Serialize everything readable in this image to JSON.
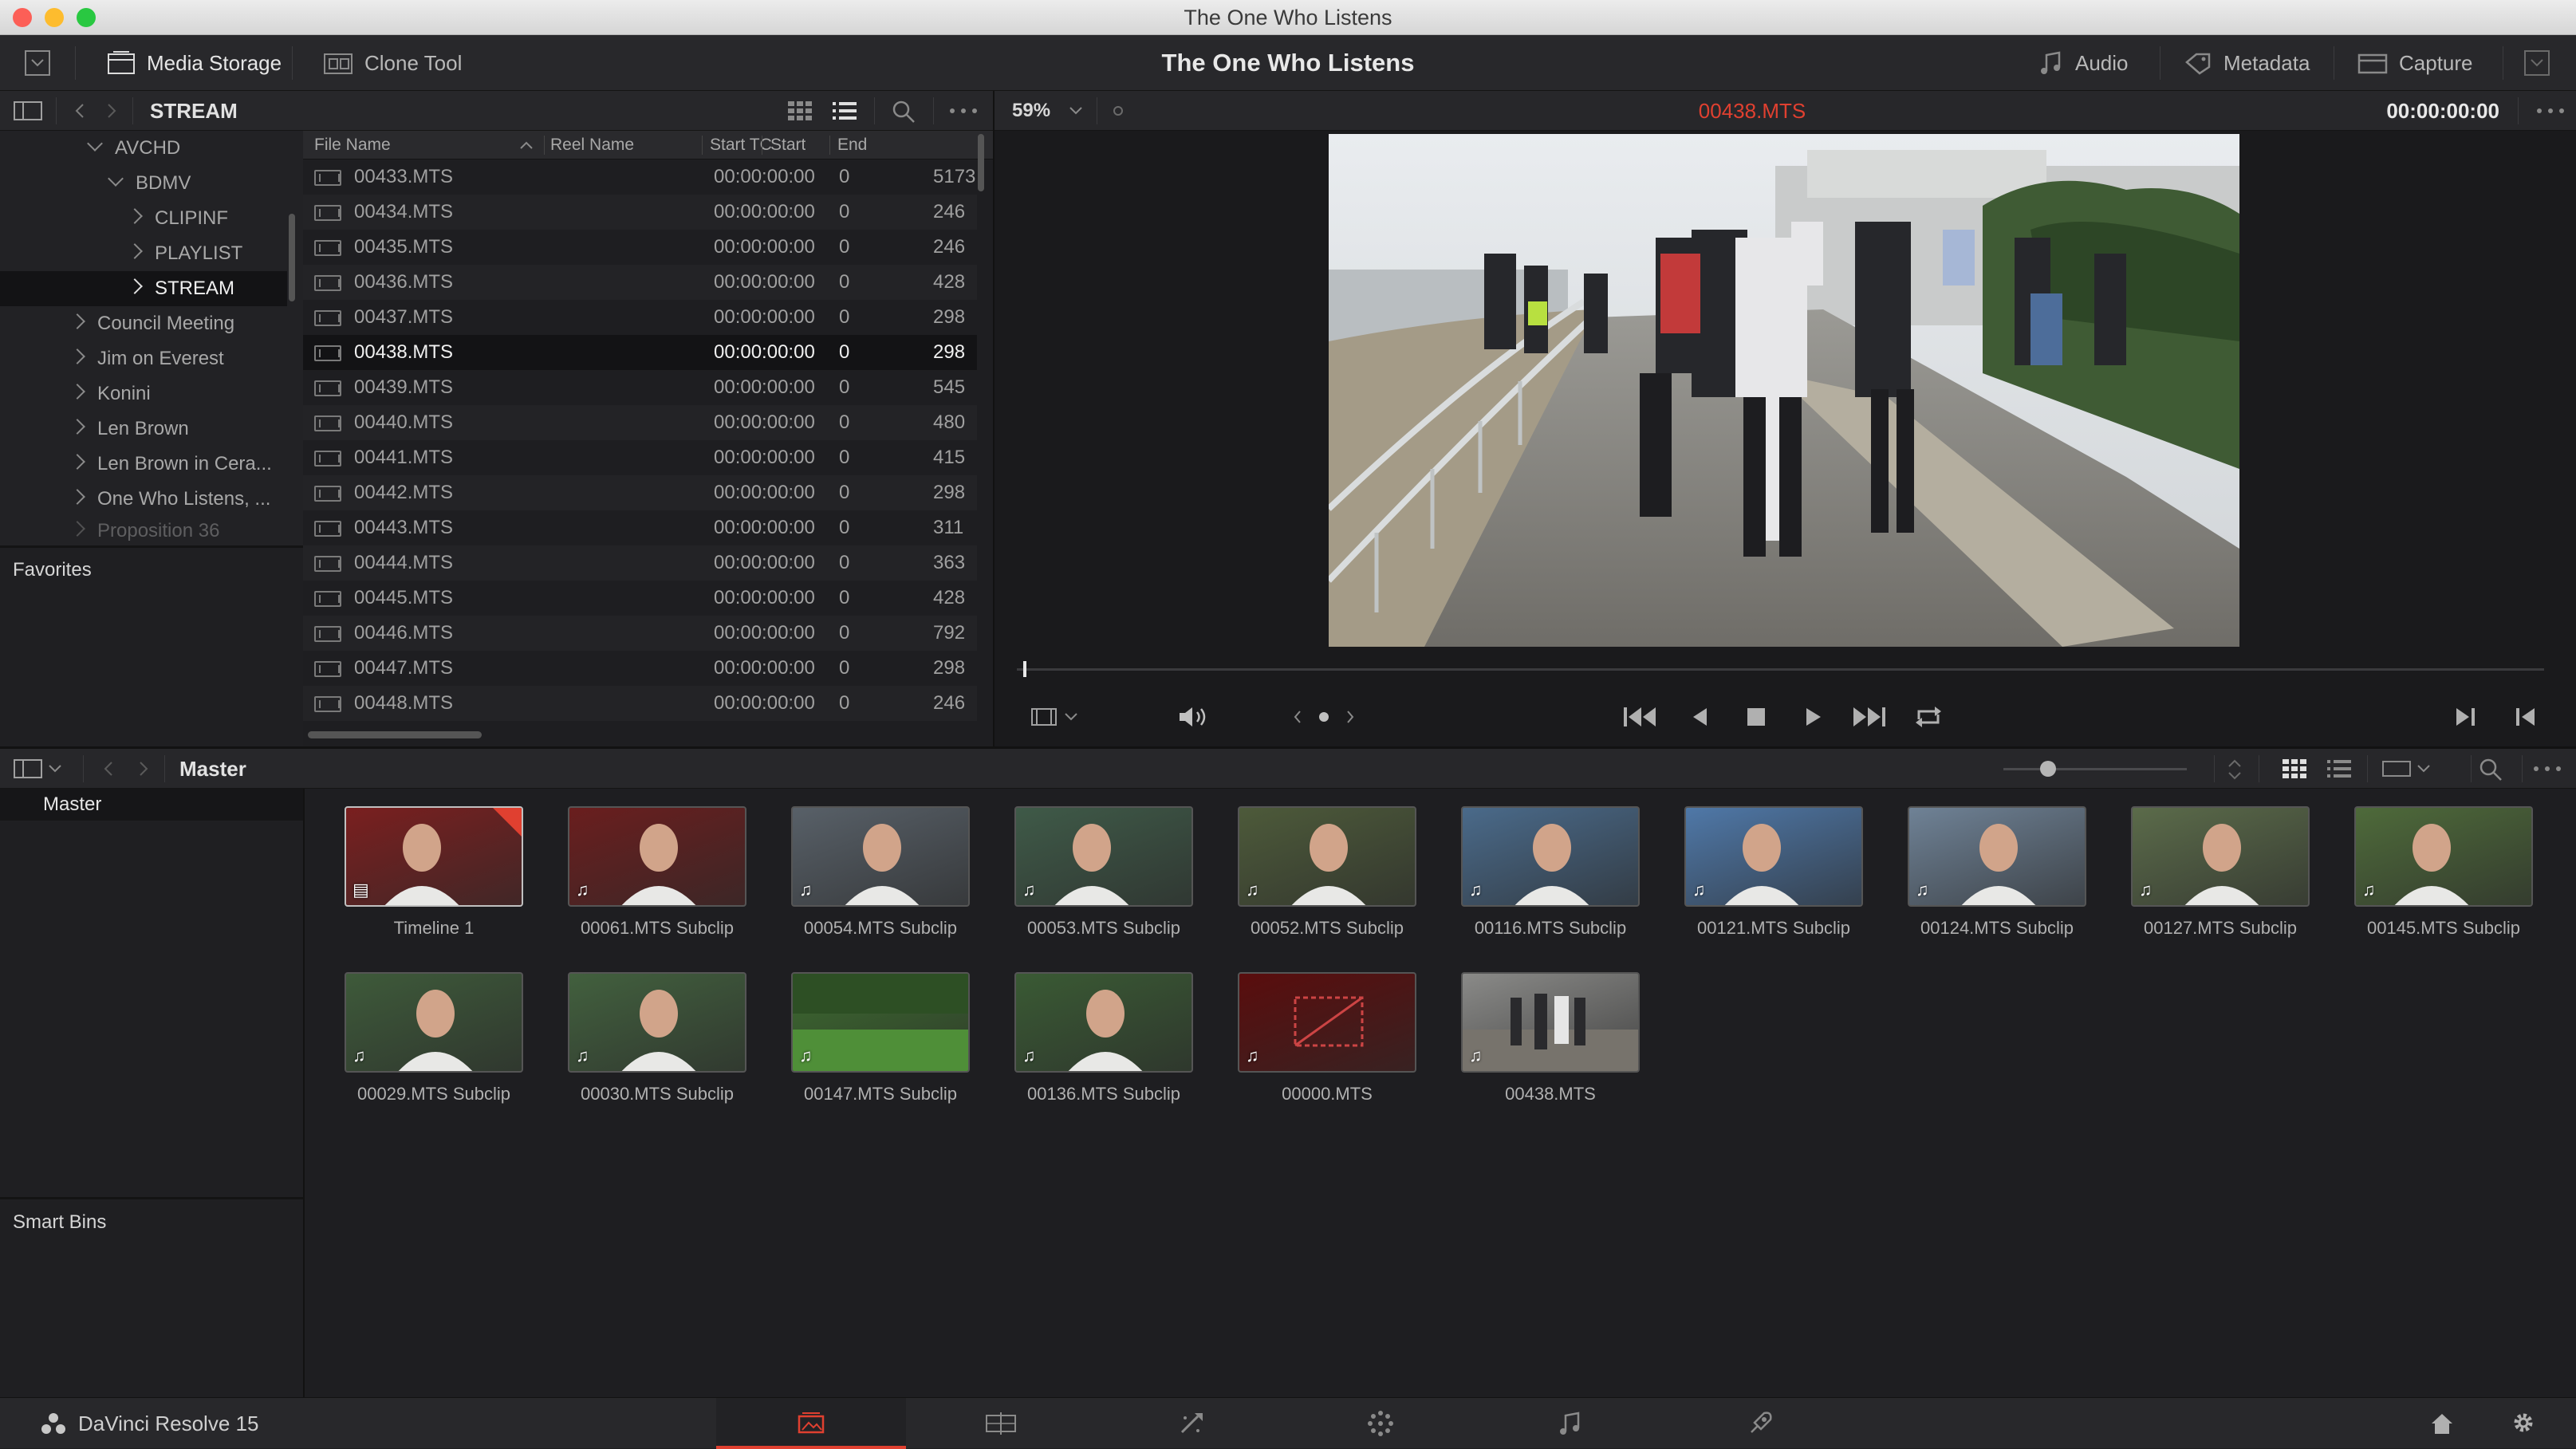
{
  "app": {
    "window_title": "The One Who Listens",
    "name": "DaVinci Resolve 15"
  },
  "toolbar": {
    "media_storage": "Media Storage",
    "clone_tool": "Clone Tool",
    "project_title": "The One Who Listens",
    "audio": "Audio",
    "metadata": "Metadata",
    "capture": "Capture"
  },
  "browser": {
    "path": "STREAM"
  },
  "tree": [
    {
      "label": "AVCHD",
      "state": "expanded"
    },
    {
      "label": "BDMV",
      "state": "expanded"
    },
    {
      "label": "CLIPINF",
      "state": "collapsed"
    },
    {
      "label": "PLAYLIST",
      "state": "collapsed"
    },
    {
      "label": "STREAM",
      "state": "selected"
    },
    {
      "label": "Council Meeting",
      "state": "collapsed"
    },
    {
      "label": "Jim on Everest",
      "state": "collapsed"
    },
    {
      "label": "Konini",
      "state": "collapsed"
    },
    {
      "label": "Len Brown",
      "state": "collapsed"
    },
    {
      "label": "Len Brown in Cera...",
      "state": "collapsed"
    },
    {
      "label": "One Who Listens, ...",
      "state": "collapsed"
    },
    {
      "label": "Proposition 36",
      "state": "collapsed"
    }
  ],
  "favorites": "Favorites",
  "files": {
    "columns": [
      "File Name",
      "Reel Name",
      "Start TC",
      "Start",
      "End"
    ],
    "rows": [
      {
        "name": "00433.MTS",
        "tc": "00:00:00:00",
        "start": "0",
        "end": "5173"
      },
      {
        "name": "00434.MTS",
        "tc": "00:00:00:00",
        "start": "0",
        "end": "246"
      },
      {
        "name": "00435.MTS",
        "tc": "00:00:00:00",
        "start": "0",
        "end": "246"
      },
      {
        "name": "00436.MTS",
        "tc": "00:00:00:00",
        "start": "0",
        "end": "428"
      },
      {
        "name": "00437.MTS",
        "tc": "00:00:00:00",
        "start": "0",
        "end": "298"
      },
      {
        "name": "00438.MTS",
        "tc": "00:00:00:00",
        "start": "0",
        "end": "298"
      },
      {
        "name": "00439.MTS",
        "tc": "00:00:00:00",
        "start": "0",
        "end": "545"
      },
      {
        "name": "00440.MTS",
        "tc": "00:00:00:00",
        "start": "0",
        "end": "480"
      },
      {
        "name": "00441.MTS",
        "tc": "00:00:00:00",
        "start": "0",
        "end": "415"
      },
      {
        "name": "00442.MTS",
        "tc": "00:00:00:00",
        "start": "0",
        "end": "298"
      },
      {
        "name": "00443.MTS",
        "tc": "00:00:00:00",
        "start": "0",
        "end": "311"
      },
      {
        "name": "00444.MTS",
        "tc": "00:00:00:00",
        "start": "0",
        "end": "363"
      },
      {
        "name": "00445.MTS",
        "tc": "00:00:00:00",
        "start": "0",
        "end": "428"
      },
      {
        "name": "00446.MTS",
        "tc": "00:00:00:00",
        "start": "0",
        "end": "792"
      },
      {
        "name": "00447.MTS",
        "tc": "00:00:00:00",
        "start": "0",
        "end": "298"
      },
      {
        "name": "00448.MTS",
        "tc": "00:00:00:00",
        "start": "0",
        "end": "246"
      }
    ]
  },
  "viewer": {
    "zoom": "59%",
    "clip_name": "00438.MTS",
    "timecode": "00:00:00:00",
    "clip_color": "#e04030"
  },
  "pool": {
    "title": "Master",
    "sidebar_master": "Master",
    "smart_bins": "Smart Bins",
    "clips": [
      {
        "label": "Timeline 1",
        "icon": "timeline-icon",
        "bg": "#7a1f1f"
      },
      {
        "label": "00061.MTS Subclip",
        "icon": "audio-note-icon",
        "bg": "#6a1e1e"
      },
      {
        "label": "00054.MTS Subclip",
        "icon": "audio-note-icon",
        "bg": "#586068"
      },
      {
        "label": "00053.MTS Subclip",
        "icon": "audio-note-icon",
        "bg": "#3f5a48"
      },
      {
        "label": "00052.MTS Subclip",
        "icon": "audio-note-icon",
        "bg": "#4d5a3a"
      },
      {
        "label": "00116.MTS Subclip",
        "icon": "audio-note-icon",
        "bg": "#4a6a8a"
      },
      {
        "label": "00121.MTS Subclip",
        "icon": "audio-note-icon",
        "bg": "#4f78a8"
      },
      {
        "label": "00124.MTS Subclip",
        "icon": "audio-note-icon",
        "bg": "#6f8296"
      },
      {
        "label": "00127.MTS Subclip",
        "icon": "audio-note-icon",
        "bg": "#5b6b4a"
      },
      {
        "label": "00145.MTS Subclip",
        "icon": "audio-note-icon",
        "bg": "#4e6a3a"
      },
      {
        "label": "00029.MTS Subclip",
        "icon": "audio-note-icon",
        "bg": "#3e5a3a"
      },
      {
        "label": "00030.MTS Subclip",
        "icon": "audio-note-icon",
        "bg": "#42603e"
      },
      {
        "label": "00147.MTS Subclip",
        "icon": "audio-note-icon",
        "bg": "#3d6b2f"
      },
      {
        "label": "00136.MTS Subclip",
        "icon": "audio-note-icon",
        "bg": "#3a5a34"
      },
      {
        "label": "00000.MTS",
        "icon": "audio-note-icon",
        "bg": "#5a0d0d"
      },
      {
        "label": "00438.MTS",
        "icon": "audio-note-icon",
        "bg": "#8a8a88"
      }
    ]
  },
  "pages": [
    "media",
    "edit",
    "fusion",
    "color",
    "fairlight",
    "deliver"
  ]
}
